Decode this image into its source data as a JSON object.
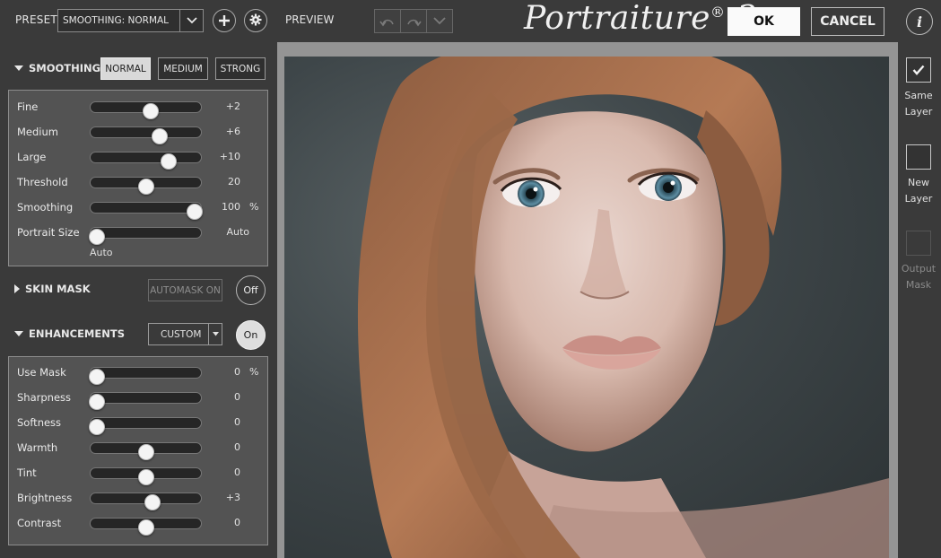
{
  "preset": {
    "label": "PRESET",
    "value": "SMOOTHING: NORMAL"
  },
  "preview": {
    "label": "PREVIEW"
  },
  "logo": {
    "name": "Portraiture",
    "mark": "®",
    "version": "3"
  },
  "actions": {
    "ok": "OK",
    "cancel": "CANCEL",
    "info": "i"
  },
  "smoothing": {
    "title": "SMOOTHING",
    "modes": [
      "NORMAL",
      "MEDIUM",
      "STRONG"
    ],
    "active_mode": "NORMAL",
    "sliders": [
      {
        "label": "Fine",
        "value": "+2",
        "unit": "",
        "level": 0.55
      },
      {
        "label": "Medium",
        "value": "+6",
        "unit": "",
        "level": 0.64
      },
      {
        "label": "Large",
        "value": "+10",
        "unit": "",
        "level": 0.73
      },
      {
        "label": "Threshold",
        "value": "20",
        "unit": "",
        "level": 0.5
      },
      {
        "label": "Smoothing",
        "value": "100",
        "unit": "%",
        "level": 1.0
      },
      {
        "label": "Portrait Size",
        "value": "Auto",
        "unit": "",
        "level": 0.0
      }
    ],
    "portrait_size_note": "Auto"
  },
  "skin_mask": {
    "title": "SKIN MASK",
    "automask": "AUTOMASK ON",
    "toggle": "Off"
  },
  "enhancements": {
    "title": "ENHANCEMENTS",
    "mode": "CUSTOM",
    "toggle": "On",
    "sliders": [
      {
        "label": "Use Mask",
        "value": "0",
        "unit": "%",
        "level": 0.0
      },
      {
        "label": "Sharpness",
        "value": "0",
        "unit": "",
        "level": 0.0
      },
      {
        "label": "Softness",
        "value": "0",
        "unit": "",
        "level": 0.0
      },
      {
        "label": "Warmth",
        "value": "0",
        "unit": "",
        "level": 0.5
      },
      {
        "label": "Tint",
        "value": "0",
        "unit": "",
        "level": 0.5
      },
      {
        "label": "Brightness",
        "value": "+3",
        "unit": "",
        "level": 0.57
      },
      {
        "label": "Contrast",
        "value": "0",
        "unit": "",
        "level": 0.5
      }
    ]
  },
  "output": [
    {
      "line1": "Same",
      "line2": "Layer",
      "checked": true,
      "enabled": true
    },
    {
      "line1": "New",
      "line2": "Layer",
      "checked": false,
      "enabled": true
    },
    {
      "line1": "Output",
      "line2": "Mask",
      "checked": false,
      "enabled": false
    }
  ]
}
